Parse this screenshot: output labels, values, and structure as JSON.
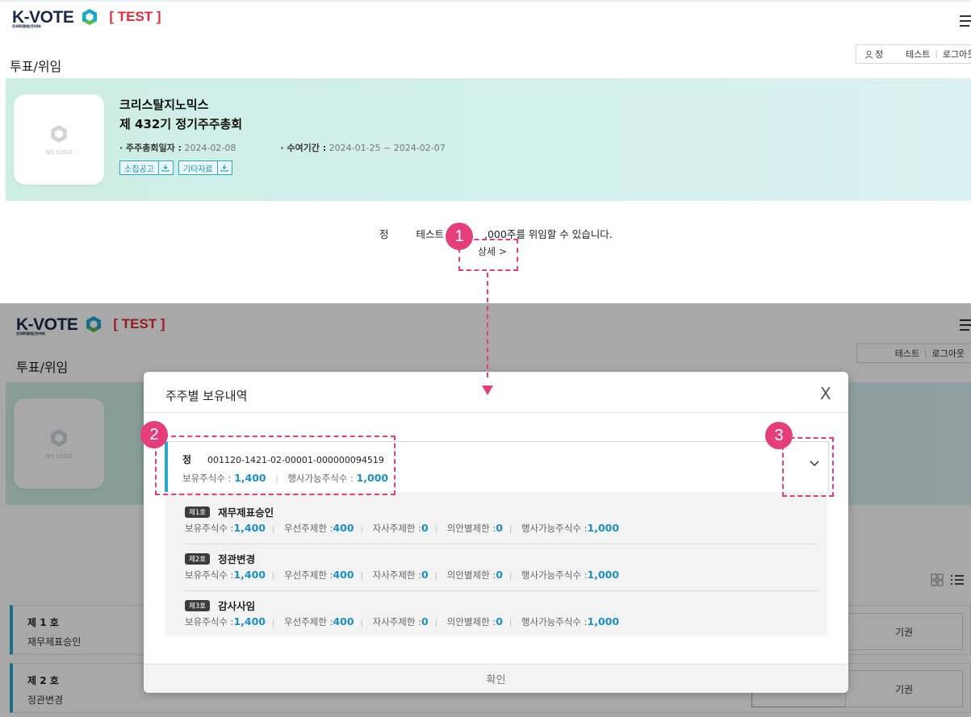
{
  "brand": {
    "logo_text": "K-VOTE",
    "subtitle": "한국예탁결제원 전자투표",
    "badge": "[ TEST ]"
  },
  "page": {
    "title": "투표/위임"
  },
  "user": {
    "name_prefix": "정",
    "name": "테스트",
    "logout": "로그아웃",
    "icon": "user-icon"
  },
  "company": {
    "name": "크리스탈지노믹스",
    "meeting": "제 432기 정기주주총회",
    "date_label": "· 주주총회일자 :",
    "date_value": "2024-02-08",
    "period_label": "· 수여기간 :",
    "period_value": "2024-01-25 ~ 2024-02-07",
    "buttons": [
      {
        "label": "소집공고"
      },
      {
        "label": "기타자료"
      }
    ],
    "nologo": "NO LOGO"
  },
  "notice": {
    "name": "정",
    "name2": "테스트",
    "text": ",000주를 위임할 수 있습니다.",
    "detail": "상세 >"
  },
  "callouts": [
    "1",
    "2",
    "3"
  ],
  "modal": {
    "title": "주주별 보유내역",
    "close": "X",
    "holder": {
      "name": "정",
      "account": "001120-1421-02-00001-000000094519",
      "held_label": "보유주식수 :",
      "held_value": "1,400",
      "exercisable_label": "행사가능주식수 :",
      "exercisable_value": "1,000"
    },
    "items": [
      {
        "badge": "제1호",
        "title": "재무제표승인",
        "held": "1,400",
        "pref": "400",
        "own": "0",
        "agenda": "0",
        "exercisable": "1,000"
      },
      {
        "badge": "제2호",
        "title": "정관변경",
        "held": "1,400",
        "pref": "400",
        "own": "0",
        "agenda": "0",
        "exercisable": "1,000"
      },
      {
        "badge": "제3호",
        "title": "감사사임",
        "held": "1,400",
        "pref": "400",
        "own": "0",
        "agenda": "0",
        "exercisable": "1,000"
      }
    ],
    "labels": {
      "held": "보유주식수 :",
      "pref": "우선주제한 :",
      "own": "자사주제한 :",
      "agenda": "의안별제한 :",
      "exercisable": "행사가능주식수 :"
    },
    "confirm": "확인"
  },
  "agenda_rows": [
    {
      "no": "제 1 호",
      "name": "재무제표승인",
      "abstain": "기권"
    },
    {
      "no": "제 2 호",
      "name": "정관변경",
      "abstain": "기권"
    }
  ],
  "colors": {
    "accent": "#2aa8c7",
    "callout": "#e53f7b",
    "number": "#1a8fc9",
    "test": "#e32a3a"
  }
}
